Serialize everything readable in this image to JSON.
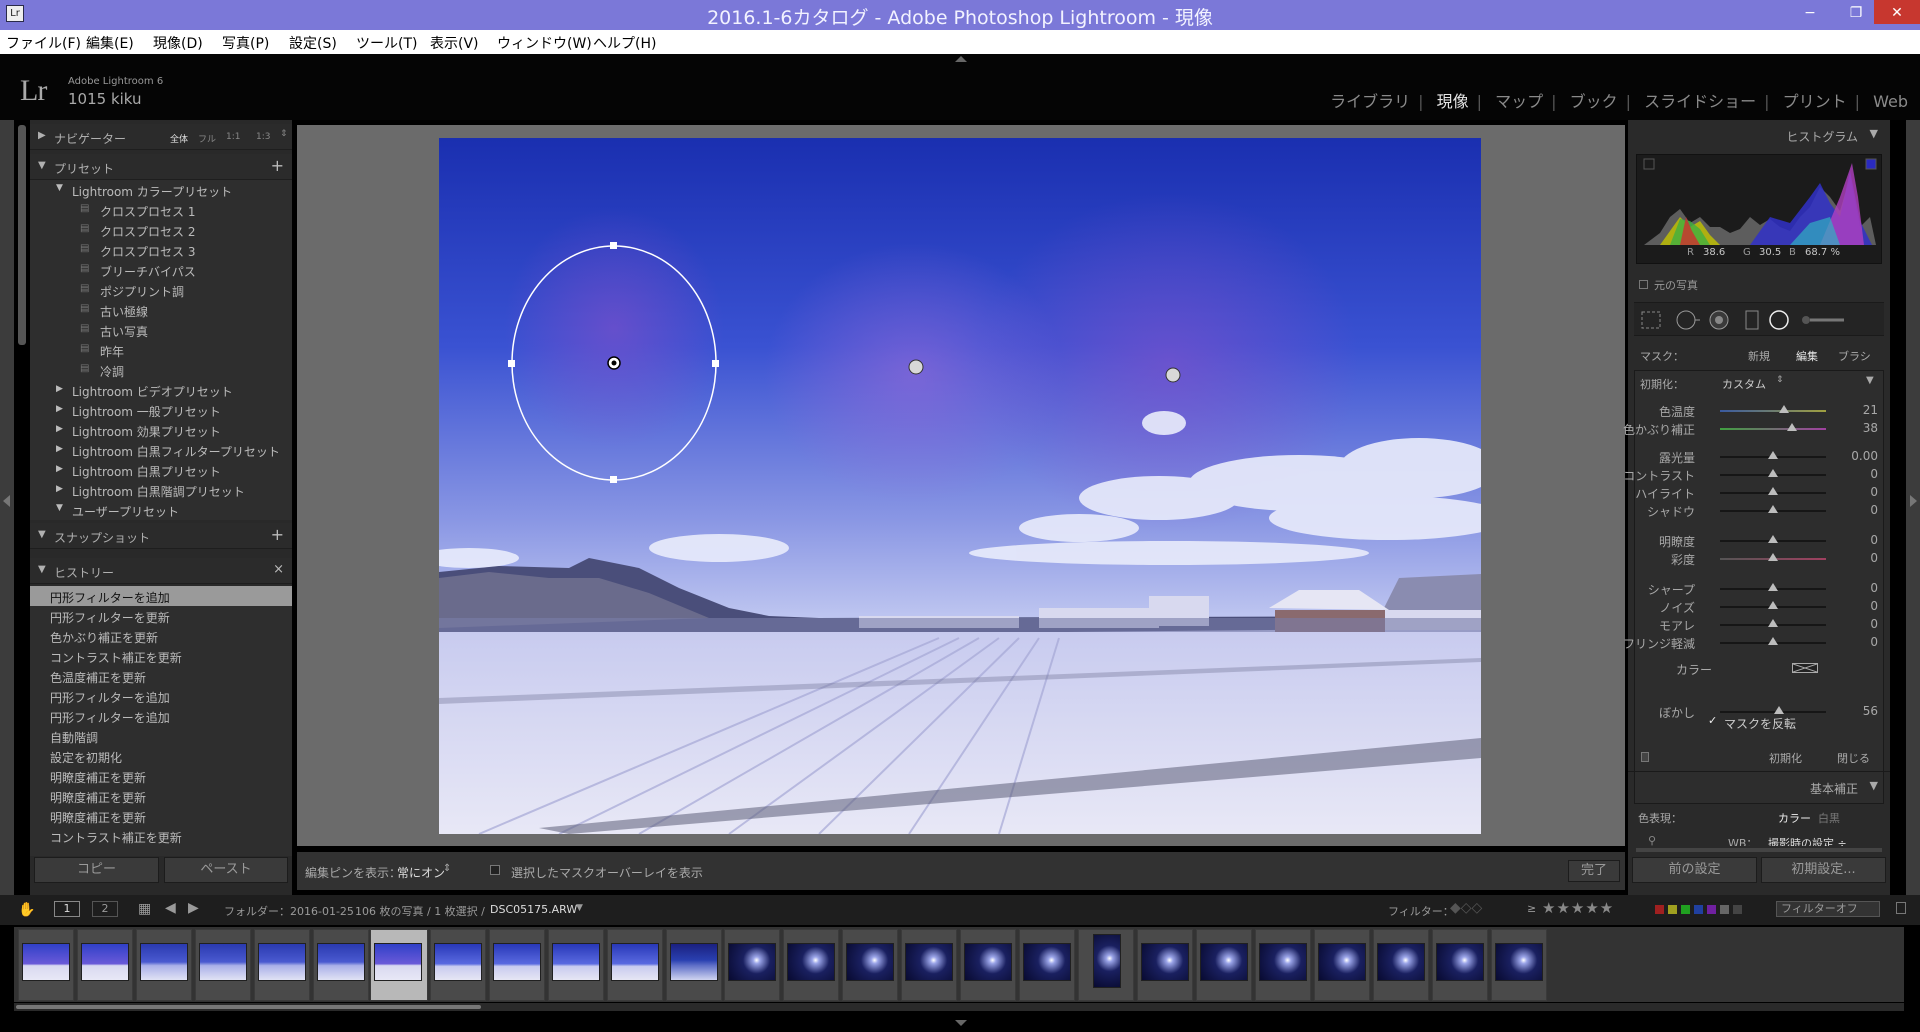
{
  "window": {
    "title": "2016.1-6カタログ - Adobe Photoshop Lightroom - 現像",
    "app_icon": "Lr",
    "minimize": "−",
    "restore": "❐",
    "close": "✕"
  },
  "menu": [
    "ファイル(F)",
    "編集(E)",
    "現像(D)",
    "写真(P)",
    "設定(S)",
    "ツール(T)",
    "表示(V)",
    "ウィンドウ(W)",
    "ヘルプ(H)"
  ],
  "identity": {
    "logo": "Lr",
    "product": "Adobe Lightroom 6",
    "user": "1015 kiku"
  },
  "modules": [
    {
      "label": "ライブラリ",
      "active": false
    },
    {
      "label": "現像",
      "active": true
    },
    {
      "label": "マップ",
      "active": false
    },
    {
      "label": "ブック",
      "active": false
    },
    {
      "label": "スライドショー",
      "active": false
    },
    {
      "label": "プリント",
      "active": false
    },
    {
      "label": "Web",
      "active": false
    }
  ],
  "left": {
    "navigator": {
      "title": "ナビゲーター",
      "zoom": [
        "全体",
        "フル",
        "1:1",
        "1:3"
      ]
    },
    "presets": {
      "title": "プリセット",
      "add": "+",
      "folders_open": {
        "name": "Lightroom カラープリセット",
        "items": [
          "クロスプロセス 1",
          "クロスプロセス 2",
          "クロスプロセス 3",
          "ブリーチバイパス",
          "ポジプリント調",
          "古い極線",
          "古い写真",
          "昨年",
          "冷調"
        ]
      },
      "folders": [
        "Lightroom ビデオプリセット",
        "Lightroom 一般プリセット",
        "Lightroom 効果プリセット",
        "Lightroom 白黒フィルタープリセット",
        "Lightroom 白黒プリセット",
        "Lightroom 白黒階調プリセット"
      ],
      "user": "ユーザープリセット"
    },
    "snapshot": {
      "title": "スナップショット",
      "add": "+"
    },
    "history": {
      "title": "ヒストリー",
      "clear": "×",
      "items": [
        "円形フィルターを追加",
        "円形フィルターを更新",
        "色かぶり補正を更新",
        "コントラスト補正を更新",
        "色温度補正を更新",
        "円形フィルターを追加",
        "円形フィルターを追加",
        "自動階調",
        "設定を初期化",
        "明瞭度補正を更新",
        "明瞭度補正を更新",
        "明瞭度補正を更新",
        "コントラスト補正を更新"
      ]
    },
    "copy": "コピー",
    "paste": "ペースト"
  },
  "toolbar": {
    "show_pins": "編集ピンを表示：",
    "pins_value": "常にオン",
    "overlay": "選択したマスクオーバーレイを表示",
    "done": "完了"
  },
  "right": {
    "histogram": {
      "title": "ヒストグラム",
      "r_label": "R",
      "r": "38.6",
      "g_label": "G",
      "g": "30.5",
      "b_label": "B",
      "b": "68.7 %",
      "original": "元の写真"
    },
    "mask": {
      "label": "マスク：",
      "new": "新規",
      "edit": "編集",
      "brush": "ブラシ"
    },
    "reset_label": "初期化：",
    "reset_value": "カスタム",
    "sliders": [
      {
        "name": "色温度",
        "value": "21",
        "pos": 0.6
      },
      {
        "name": "色かぶり補正",
        "value": "38",
        "pos": 0.68
      },
      {
        "name": "露光量",
        "value": "0.00",
        "pos": 0.5
      },
      {
        "name": "コントラスト",
        "value": "0",
        "pos": 0.5
      },
      {
        "name": "ハイライト",
        "value": "0",
        "pos": 0.5
      },
      {
        "name": "シャドウ",
        "value": "0",
        "pos": 0.5
      },
      {
        "name": "明瞭度",
        "value": "0",
        "pos": 0.5
      },
      {
        "name": "彩度",
        "value": "0",
        "pos": 0.5
      },
      {
        "name": "シャープ",
        "value": "0",
        "pos": 0.5
      },
      {
        "name": "ノイズ",
        "value": "0",
        "pos": 0.5
      },
      {
        "name": "モアレ",
        "value": "0",
        "pos": 0.5
      },
      {
        "name": "フリンジ軽減",
        "value": "0",
        "pos": 0.5
      }
    ],
    "color_label": "カラー",
    "feather": {
      "name": "ぼかし",
      "value": "56",
      "pos": 0.56
    },
    "invert": "マスクを反転",
    "panel_reset": "初期化",
    "panel_close": "閉じる",
    "basic": {
      "title": "基本補正",
      "treatment": "色表現：",
      "color": "カラー",
      "bw": "白黒",
      "wb_label": "WB：",
      "wb_value": "撮影時の設定 ÷"
    },
    "prev": "前の設定",
    "reset": "初期設定..."
  },
  "filmbar": {
    "page1": "1",
    "page2": "2",
    "folder": "フォルダー：2016-01-25",
    "count": "106 枚の写真 / 1 枚選択 /",
    "file": "DSC05175.ARW",
    "filter_label": "フィルター：",
    "rating_op": "≥",
    "stars": "★★★★★",
    "filter_off": "フィルターオフ"
  },
  "colors": {
    "accent_blue": "#3f3ecb",
    "panel": "#292929",
    "sky_top": "#1c33b3",
    "sky_bottom": "#cccff2"
  }
}
